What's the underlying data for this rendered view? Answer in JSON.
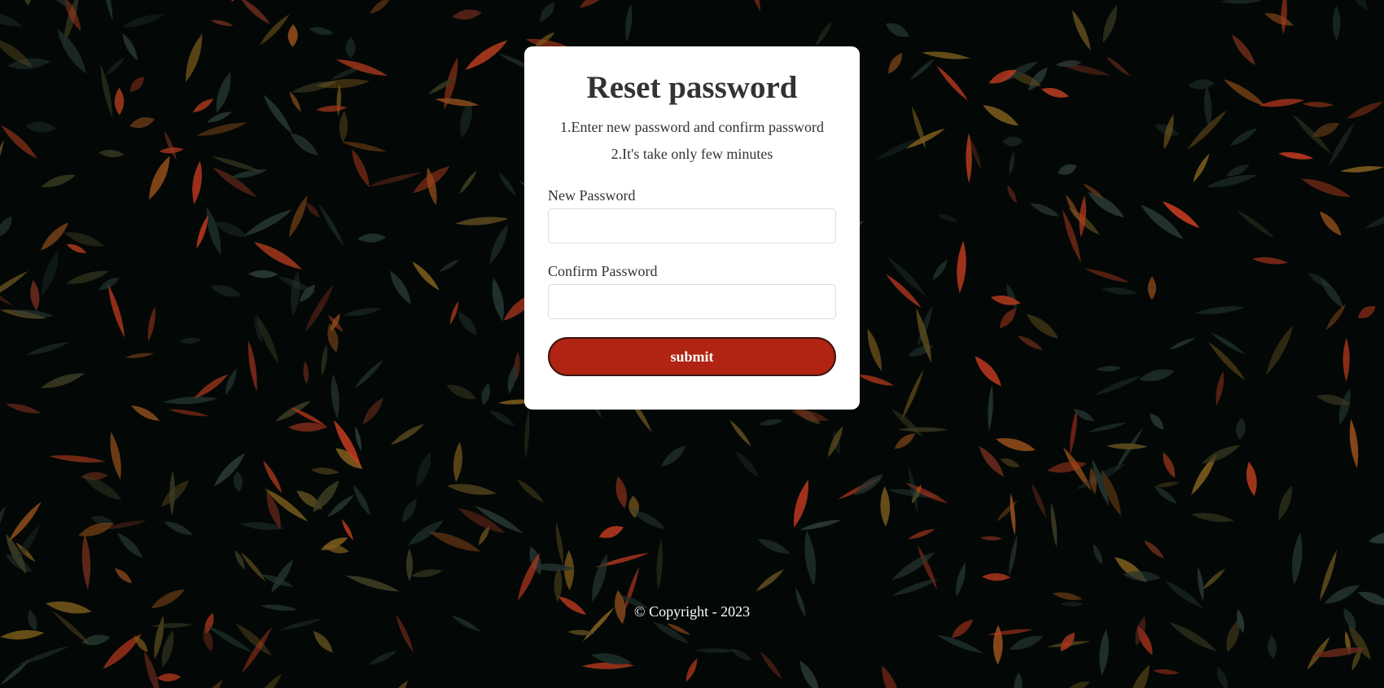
{
  "page": {
    "background_image": "dark-foliage-leaves",
    "accent_color": "#b12312"
  },
  "card": {
    "title": "Reset password",
    "instructions": [
      "1.Enter new password and confirm password",
      "2.It's take only few minutes"
    ],
    "new_password": {
      "label": "New Password",
      "value": "",
      "placeholder": ""
    },
    "confirm_password": {
      "label": "Confirm Password",
      "value": "",
      "placeholder": ""
    },
    "submit_label": "submit"
  },
  "footer": {
    "copyright": "© Copyright - 2023"
  }
}
